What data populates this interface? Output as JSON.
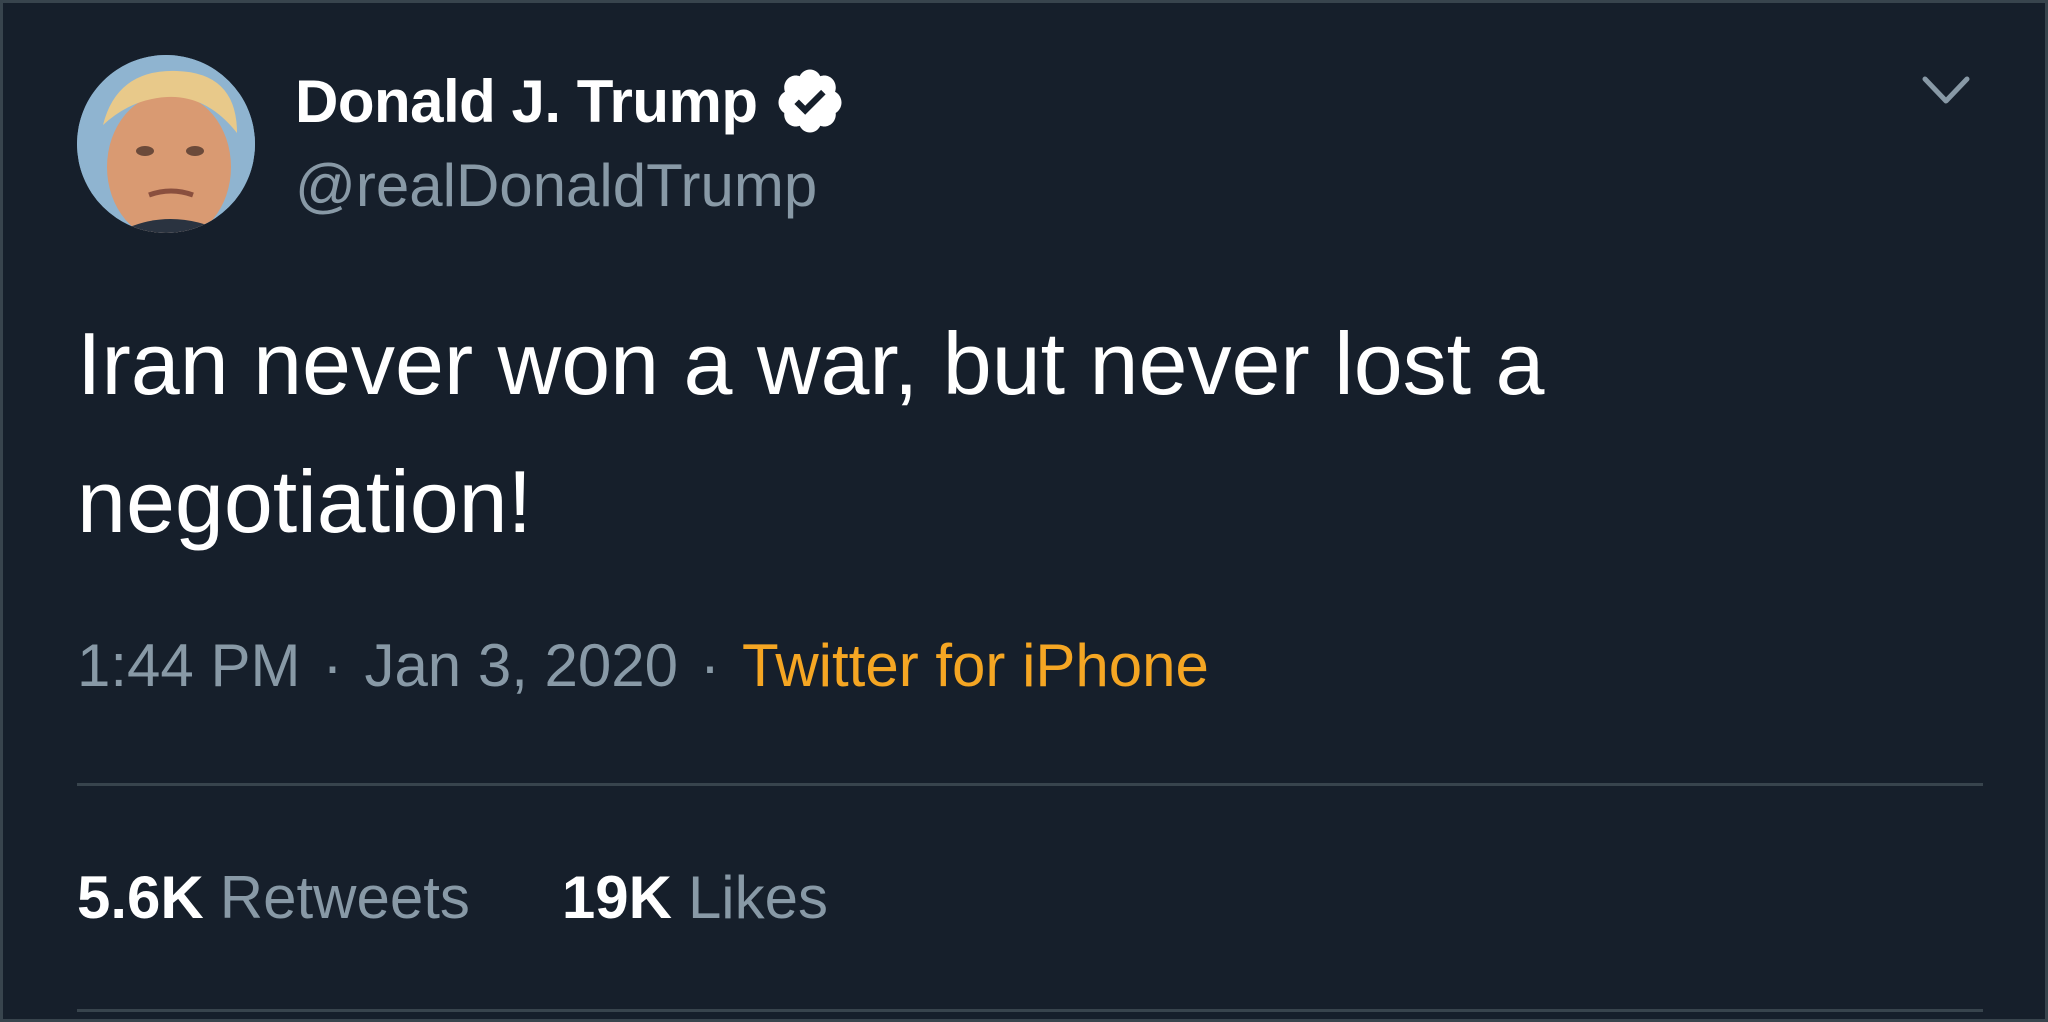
{
  "user": {
    "display_name": "Donald J. Trump",
    "handle": "@realDonaldTrump",
    "verified": true
  },
  "tweet": {
    "text": "Iran never won a war, but never lost a\nnegotiation!",
    "time": "1:44 PM",
    "separator": "·",
    "date": "Jan 3, 2020",
    "source": "Twitter for iPhone"
  },
  "stats": [
    {
      "count": "5.6K",
      "label": "Retweets"
    },
    {
      "count": "19K",
      "label": "Likes"
    }
  ],
  "icons": {
    "verified": "verified-badge-icon",
    "menu": "chevron-down-icon"
  },
  "colors": {
    "background": "#161f2b",
    "text_primary": "#ffffff",
    "text_secondary": "#8899a6",
    "source_link": "#f5a623",
    "divider": "#38444d"
  }
}
